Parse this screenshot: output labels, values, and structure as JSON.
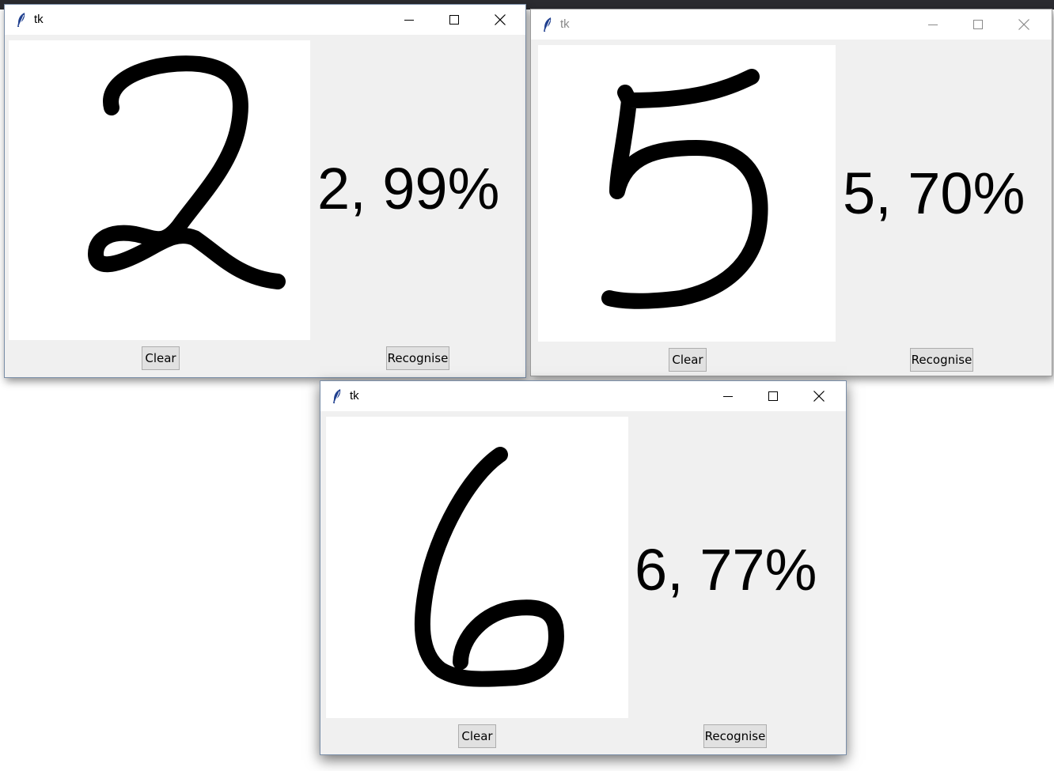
{
  "windows": [
    {
      "title": "tk",
      "result": "2, 99%",
      "clear_label": "Clear",
      "recognise_label": "Recognise",
      "digit_drawn": "2"
    },
    {
      "title": "tk",
      "result": "5, 70%",
      "clear_label": "Clear",
      "recognise_label": "Recognise",
      "digit_drawn": "5"
    },
    {
      "title": "tk",
      "result": "6, 77%",
      "clear_label": "Clear",
      "recognise_label": "Recognise",
      "digit_drawn": "6"
    }
  ],
  "icons": {
    "app": "feather-icon",
    "minimize": "minimize-icon",
    "maximize": "maximize-icon",
    "close": "close-icon"
  },
  "colors": {
    "window_bg": "#f0f0f0",
    "canvas_bg": "#ffffff",
    "stroke": "#000000",
    "titlebar_bg": "#ffffff"
  }
}
